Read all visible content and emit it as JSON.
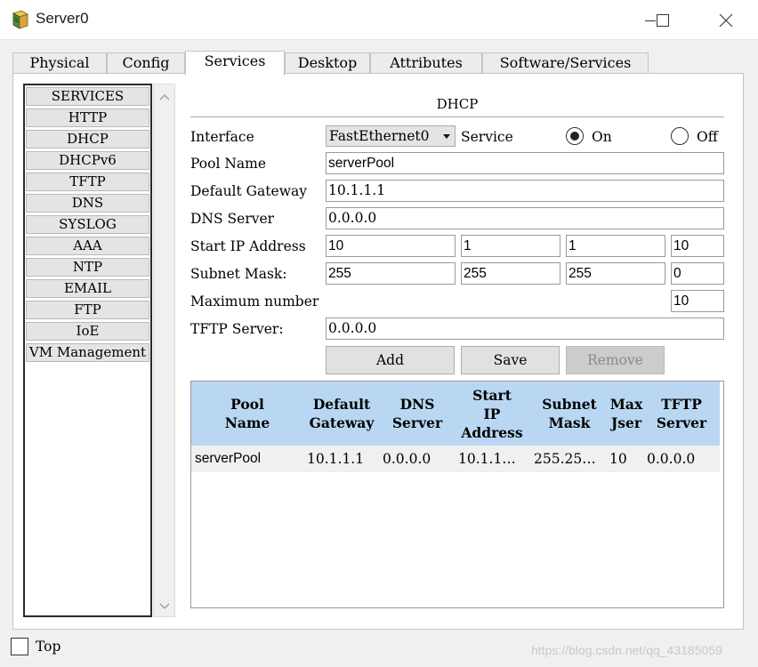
{
  "window": {
    "title": "Server0",
    "icon": "server-app-icon",
    "minimize_icon": "minimize-icon",
    "maximize_icon": "maximize-icon",
    "close_icon": "close-icon"
  },
  "tabs": [
    {
      "label": "Physical",
      "active": false
    },
    {
      "label": "Config",
      "active": false
    },
    {
      "label": "Services",
      "active": true
    },
    {
      "label": "Desktop",
      "active": false
    },
    {
      "label": "Attributes",
      "active": false
    },
    {
      "label": "Software/Services",
      "active": false
    }
  ],
  "services": {
    "items": [
      {
        "label": "SERVICES"
      },
      {
        "label": "HTTP"
      },
      {
        "label": "DHCP"
      },
      {
        "label": "DHCPv6"
      },
      {
        "label": "TFTP"
      },
      {
        "label": "DNS"
      },
      {
        "label": "SYSLOG"
      },
      {
        "label": "AAA"
      },
      {
        "label": "NTP"
      },
      {
        "label": "EMAIL"
      },
      {
        "label": "FTP"
      },
      {
        "label": "IoE"
      },
      {
        "label": "VM Management"
      }
    ]
  },
  "dhcp": {
    "heading": "DHCP",
    "interface_label": "Interface",
    "interface_value": "FastEthernet0",
    "service_label": "Service",
    "on_label": "On",
    "off_label": "Off",
    "service_state": "On",
    "pool_name_label": "Pool Name",
    "pool_name_value": "serverPool",
    "default_gateway_label": "Default Gateway",
    "default_gateway_value": "10.1.1.1",
    "dns_server_label": "DNS Server",
    "dns_server_value": "0.0.0.0",
    "start_ip_label": "Start IP Address",
    "start_ip": [
      "10",
      "1",
      "1",
      "10"
    ],
    "subnet_mask_label": "Subnet Mask:",
    "subnet_mask": [
      "255",
      "255",
      "255",
      "0"
    ],
    "max_users_label": "Maximum number o",
    "max_users_value": "10",
    "tftp_server_label": "TFTP Server:",
    "tftp_server_value": "0.0.0.0",
    "buttons": {
      "add": "Add",
      "save": "Save",
      "remove": "Remove"
    },
    "table": {
      "headers": [
        {
          "line1": "Pool",
          "line2": "Name",
          "line3": ""
        },
        {
          "line1": "Default",
          "line2": "Gateway",
          "line3": ""
        },
        {
          "line1": "DNS",
          "line2": "Server",
          "line3": ""
        },
        {
          "line1": "Start",
          "line2": "IP",
          "line3": "Address"
        },
        {
          "line1": "Subnet",
          "line2": "Mask",
          "line3": ""
        },
        {
          "line1": "Max",
          "line2": "Jser",
          "line3": ""
        },
        {
          "line1": "TFTP",
          "line2": "Server",
          "line3": ""
        }
      ],
      "rows": [
        {
          "pool_name": "serverPool",
          "default_gateway": "10.1.1.1",
          "dns_server": "0.0.0.0",
          "start_ip": "10.1.1…",
          "subnet_mask": "255.25…",
          "max_users": "10",
          "tftp_server": "0.0.0.0"
        }
      ]
    }
  },
  "footer": {
    "top_label": "Top",
    "watermark": "https://blog.csdn.net/qq_43185059"
  }
}
